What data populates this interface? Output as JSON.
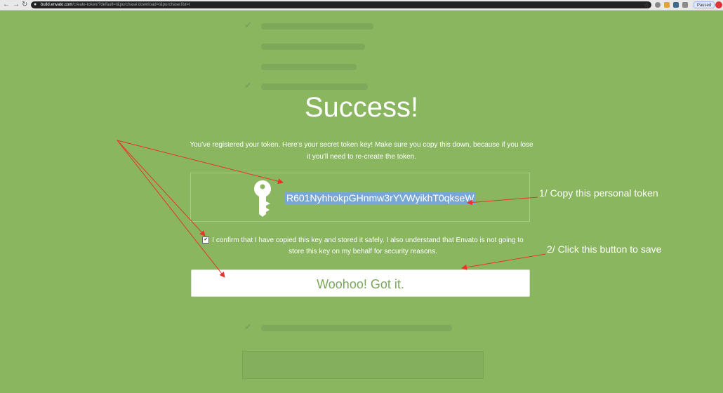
{
  "browser": {
    "url_host": "build.envato.com",
    "url_path": "/create-token/?default=t&purchase:download=t&purchase:list=t",
    "paused_label": "Paused"
  },
  "page": {
    "title": "Success!",
    "description": "You've registered your token. Here's your secret token key! Make sure you copy this down, because if you lose it you'll need to re-create the token.",
    "token": "R601NyhhokpGHnmw3rYVWyikhT0qkseW",
    "confirm_text": "I confirm that I have copied this key and stored it safely. I also understand that Envato is not going to store this key on my behalf for security reasons.",
    "button_label": "Woohoo! Got it."
  },
  "annotations": {
    "note_copy": "1/ Copy this personal token",
    "note_save": "2/ Click this button to save",
    "arrow_color": "#e8332a"
  },
  "colors": {
    "background": "#8ab660",
    "button_text": "#7aa85a",
    "token_highlight": "#78a7d1"
  }
}
